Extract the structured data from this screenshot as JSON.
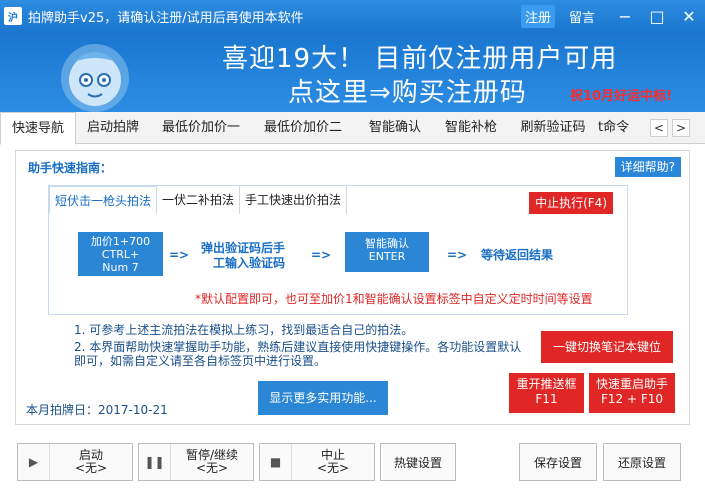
{
  "window": {
    "app_icon_text": "沪",
    "title": "拍牌助手v25，请确认注册/试用后再使用本软件",
    "register": "注册",
    "message": "留言",
    "minimize": "−",
    "maximize": "□",
    "close": "✕"
  },
  "banner": {
    "line1": "喜迎19大！ 目前仅注册用户可用",
    "line2": "点这里⇒购买注册码",
    "note": "祝10月好运中标!"
  },
  "tabs": [
    {
      "label": "快速导航"
    },
    {
      "label": "启动拍牌"
    },
    {
      "label": "最低价加价一"
    },
    {
      "label": "最低价加价二"
    },
    {
      "label": "智能确认"
    },
    {
      "label": "智能补枪"
    },
    {
      "label": "刷新验证码"
    },
    {
      "label": "t命令"
    }
  ],
  "tab_prev": "<",
  "tab_next": ">",
  "guide": {
    "title": "助手快速指南：",
    "help": "详细帮助?",
    "subtabs": [
      {
        "label": "短伏击一枪头拍法"
      },
      {
        "label": "一伏二补拍法"
      },
      {
        "label": "手工快速出价拍法"
      }
    ],
    "stop_exec": "中止执行(F4)",
    "step1": {
      "line1": "加价1+700",
      "line2": "CTRL+",
      "line3": "Num 7"
    },
    "arrow": "=>",
    "step2": {
      "line1": "弹出验证码后手",
      "line2": "工输入验证码"
    },
    "step3": {
      "line1": "智能确认",
      "line2": "ENTER"
    },
    "step4": "等待返回结果",
    "hint": "*默认配置即可，也可至加价1和智能确认设置标签中自定义定时时间等设置"
  },
  "tips": [
    "1. 可参考上述主流拍法在模拟上练习，找到最适合自己的拍法。",
    "2. 本界面帮助快速掌握助手功能，熟练后建议直接使用快捷键操作。各功能设置默认即可，如需自定义请至各自标签页中进行设置。"
  ],
  "buttons_red": {
    "switch_notebook": "一键切换笔记本键位",
    "restart_push": {
      "line1": "重开推送框",
      "line2": "F11"
    },
    "quick_restart": {
      "line1": "快速重启助手",
      "line2": "F12 + F10"
    }
  },
  "date_label": "本月拍牌日：2017-10-21",
  "more_features": "显示更多实用功能...",
  "toolbar": {
    "start": {
      "label": "启动",
      "hotkey": "<无>"
    },
    "pause": {
      "label": "暂停/继续",
      "hotkey": "<无>"
    },
    "stop": {
      "label": "中止",
      "hotkey": "<无>"
    },
    "hotkey_settings": "热键设置",
    "save_settings": "保存设置",
    "restore_settings": "还原设置"
  },
  "colors": {
    "title_blue": "#1a76cf",
    "accent_blue": "#2b87d6",
    "alert_red": "#e12626"
  }
}
